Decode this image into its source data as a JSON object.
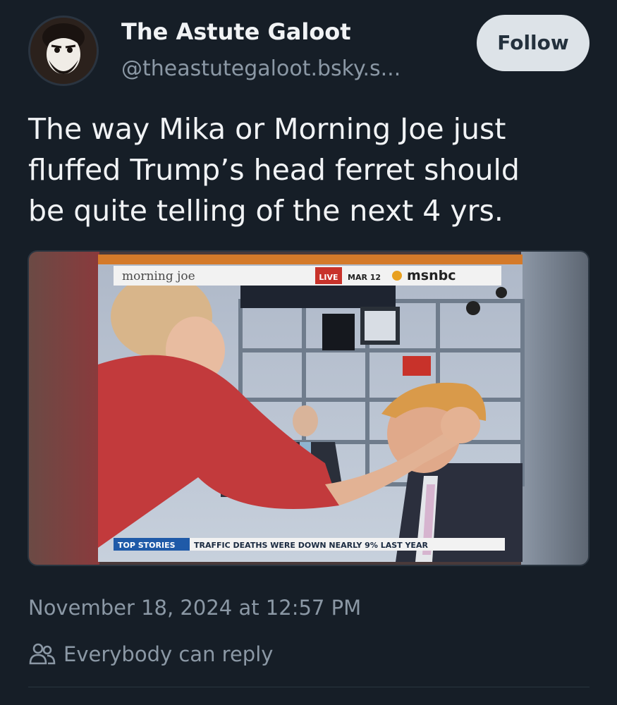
{
  "author": {
    "display_name": "The Astute Galoot",
    "handle": "@theastutegaloot.bsky.s..."
  },
  "follow_label": "Follow",
  "post": {
    "text_lines": [
      "The way Mika or Morning Joe just",
      "fluffed Trump’s head ferret should",
      "be quite telling of the next 4 yrs."
    ]
  },
  "embed": {
    "show_name": "morning joe",
    "live_badge": "LIVE",
    "date": "MAR 12",
    "network": "msnbc",
    "ticker_label": "TOP STORIES",
    "ticker_text": "TRAFFIC DEATHS WERE DOWN NEARLY 9% LAST YEAR"
  },
  "timestamp": "November 18, 2024 at 12:57 PM",
  "reply_setting": "Everybody can reply",
  "icons": {
    "reply_setting_icon": "people-icon"
  },
  "colors": {
    "background": "#161e27",
    "primary_text": "#f1f3f5",
    "secondary_text": "#8b98a5",
    "follow_button_bg": "#dde3e8",
    "follow_button_text": "#24313d"
  }
}
